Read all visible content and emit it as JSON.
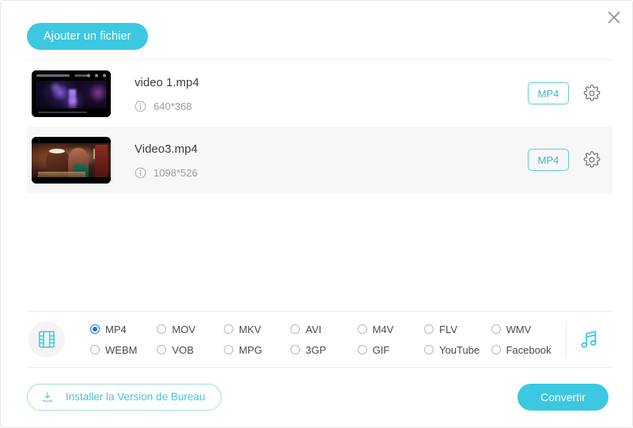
{
  "window": {
    "close_label": "×",
    "accent_color": "#3cc8e0",
    "accent_border_color": "#5ecbdd",
    "radio_checked_color": "#1a73e8",
    "alt_row_bg": "#f7f7f7"
  },
  "toolbar": {
    "add_file_label": "Ajouter un fichier"
  },
  "files": [
    {
      "name": "video 1.mp4",
      "resolution": "640*368",
      "format_label": "MP4",
      "thumb_kind": "fireworks"
    },
    {
      "name": "Video3.mp4",
      "resolution": "1098*526",
      "format_label": "MP4",
      "thumb_kind": "scene"
    }
  ],
  "format_bar": {
    "video_icon": "film-icon",
    "audio_icon": "music-note-icon",
    "options": [
      {
        "label": "MP4",
        "checked": true
      },
      {
        "label": "MOV",
        "checked": false
      },
      {
        "label": "MKV",
        "checked": false
      },
      {
        "label": "AVI",
        "checked": false
      },
      {
        "label": "M4V",
        "checked": false
      },
      {
        "label": "FLV",
        "checked": false
      },
      {
        "label": "WMV",
        "checked": false
      },
      {
        "label": "WEBM",
        "checked": false
      },
      {
        "label": "VOB",
        "checked": false
      },
      {
        "label": "MPG",
        "checked": false
      },
      {
        "label": "3GP",
        "checked": false
      },
      {
        "label": "GIF",
        "checked": false
      },
      {
        "label": "YouTube",
        "checked": false
      },
      {
        "label": "Facebook",
        "checked": false
      }
    ]
  },
  "footer": {
    "install_label": "Installer la Version de Bureau",
    "convert_label": "Convertir"
  }
}
